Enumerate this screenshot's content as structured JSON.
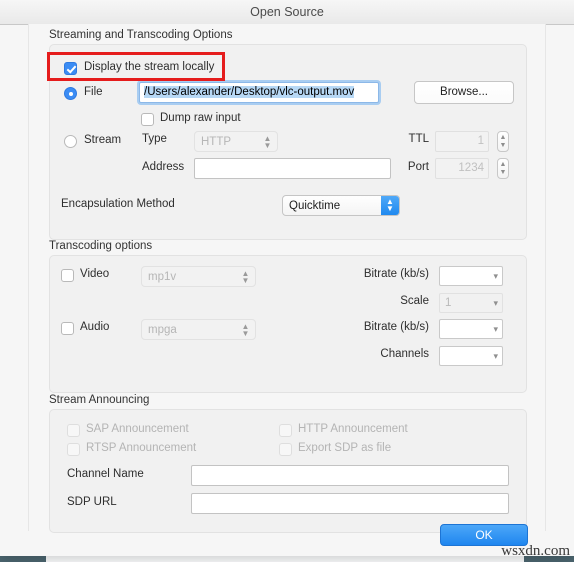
{
  "window": {
    "title": "Open Source"
  },
  "sections": {
    "streaming": {
      "title": "Streaming and Transcoding Options",
      "display_locally_label": "Display the stream locally",
      "display_locally_checked": true,
      "file_radio_label": "File",
      "file_radio_selected": true,
      "file_path_value": "/Users/alexander/Desktop/vlc-output.mov",
      "browse_label": "Browse...",
      "dump_raw_label": "Dump raw input",
      "dump_raw_checked": false,
      "stream_radio_label": "Stream",
      "stream_radio_selected": false,
      "type_label": "Type",
      "type_value": "HTTP",
      "address_label": "Address",
      "address_value": "",
      "ttl_label": "TTL",
      "ttl_value": "1",
      "port_label": "Port",
      "port_value": "1234",
      "encapsulation_label": "Encapsulation Method",
      "encapsulation_value": "Quicktime"
    },
    "transcoding": {
      "title": "Transcoding options",
      "video_label": "Video",
      "video_checked": false,
      "video_codec_value": "mp1v",
      "video_bitrate_label": "Bitrate (kb/s)",
      "video_bitrate_value": "",
      "scale_label": "Scale",
      "scale_value": "1",
      "audio_label": "Audio",
      "audio_checked": false,
      "audio_codec_value": "mpga",
      "audio_bitrate_label": "Bitrate (kb/s)",
      "audio_bitrate_value": "",
      "channels_label": "Channels",
      "channels_value": ""
    },
    "announcing": {
      "title": "Stream Announcing",
      "sap_label": "SAP Announcement",
      "sap_checked": false,
      "http_label": "HTTP Announcement",
      "http_checked": false,
      "rtsp_label": "RTSP Announcement",
      "rtsp_checked": false,
      "export_sdp_label": "Export SDP as file",
      "export_sdp_checked": false,
      "channel_name_label": "Channel Name",
      "channel_name_value": "",
      "sdp_url_label": "SDP URL",
      "sdp_url_value": ""
    }
  },
  "footer": {
    "ok_label": "OK"
  },
  "annotation": {
    "highlight_color": "#e51c1c"
  },
  "watermark": {
    "text": "wsxdn.com"
  },
  "icons": {
    "stepper_up": "▲",
    "stepper_down": "▼",
    "chevron_down": "⌄"
  }
}
